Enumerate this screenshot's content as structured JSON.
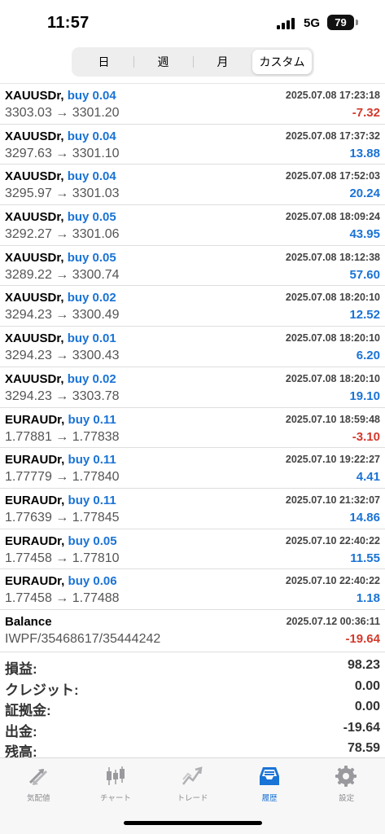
{
  "status_bar": {
    "time": "11:57",
    "network": "5G",
    "battery": "79"
  },
  "period_tabs": [
    {
      "label": "日"
    },
    {
      "label": "週"
    },
    {
      "label": "月"
    },
    {
      "label": "カスタム"
    }
  ],
  "active_period": "カスタム",
  "trades": [
    {
      "symbol": "XAUUSDr,",
      "side": "buy 0.04",
      "prices": "3303.03 → 3301.20",
      "time": "2025.07.08 17:23:18",
      "profit": "-7.32"
    },
    {
      "symbol": "XAUUSDr,",
      "side": "buy 0.04",
      "prices": "3297.63 → 3301.10",
      "time": "2025.07.08 17:37:32",
      "profit": "13.88"
    },
    {
      "symbol": "XAUUSDr,",
      "side": "buy 0.04",
      "prices": "3295.97 → 3301.03",
      "time": "2025.07.08 17:52:03",
      "profit": "20.24"
    },
    {
      "symbol": "XAUUSDr,",
      "side": "buy 0.05",
      "prices": "3292.27 → 3301.06",
      "time": "2025.07.08 18:09:24",
      "profit": "43.95"
    },
    {
      "symbol": "XAUUSDr,",
      "side": "buy 0.05",
      "prices": "3289.22 → 3300.74",
      "time": "2025.07.08 18:12:38",
      "profit": "57.60"
    },
    {
      "symbol": "XAUUSDr,",
      "side": "buy 0.02",
      "prices": "3294.23 → 3300.49",
      "time": "2025.07.08 18:20:10",
      "profit": "12.52"
    },
    {
      "symbol": "XAUUSDr,",
      "side": "buy 0.01",
      "prices": "3294.23 → 3300.43",
      "time": "2025.07.08 18:20:10",
      "profit": "6.20"
    },
    {
      "symbol": "XAUUSDr,",
      "side": "buy 0.02",
      "prices": "3294.23 → 3303.78",
      "time": "2025.07.08 18:20:10",
      "profit": "19.10"
    },
    {
      "symbol": "EURAUDr,",
      "side": "buy 0.11",
      "prices": "1.77881 → 1.77838",
      "time": "2025.07.10 18:59:48",
      "profit": "-3.10"
    },
    {
      "symbol": "EURAUDr,",
      "side": "buy 0.11",
      "prices": "1.77779 → 1.77840",
      "time": "2025.07.10 19:22:27",
      "profit": "4.41"
    },
    {
      "symbol": "EURAUDr,",
      "side": "buy 0.11",
      "prices": "1.77639 → 1.77845",
      "time": "2025.07.10 21:32:07",
      "profit": "14.86"
    },
    {
      "symbol": "EURAUDr,",
      "side": "buy 0.05",
      "prices": "1.77458 → 1.77810",
      "time": "2025.07.10 22:40:22",
      "profit": "11.55"
    },
    {
      "symbol": "EURAUDr,",
      "side": "buy 0.06",
      "prices": "1.77458 → 1.77488",
      "time": "2025.07.10 22:40:22",
      "profit": "1.18"
    }
  ],
  "balance": {
    "label": "Balance",
    "comment": "IWPF/35468617/35444242",
    "time": "2025.07.12 00:36:11",
    "amount": "-19.64"
  },
  "summary": [
    {
      "label": "損益:",
      "value": "98.23"
    },
    {
      "label": "クレジット:",
      "value": "0.00"
    },
    {
      "label": "証拠金:",
      "value": "0.00"
    },
    {
      "label": "出金:",
      "value": "-19.64"
    },
    {
      "label": "残高:",
      "value": "78.59"
    }
  ],
  "tabbar": [
    {
      "label": "気配値",
      "icon": "quotes-icon"
    },
    {
      "label": "チャート",
      "icon": "chart-icon"
    },
    {
      "label": "トレード",
      "icon": "trade-icon"
    },
    {
      "label": "履歴",
      "icon": "history-icon"
    },
    {
      "label": "設定",
      "icon": "settings-icon"
    }
  ],
  "active_tab": "履歴",
  "colors": {
    "accent": "#1a73d6",
    "loss": "#d33a2c"
  }
}
